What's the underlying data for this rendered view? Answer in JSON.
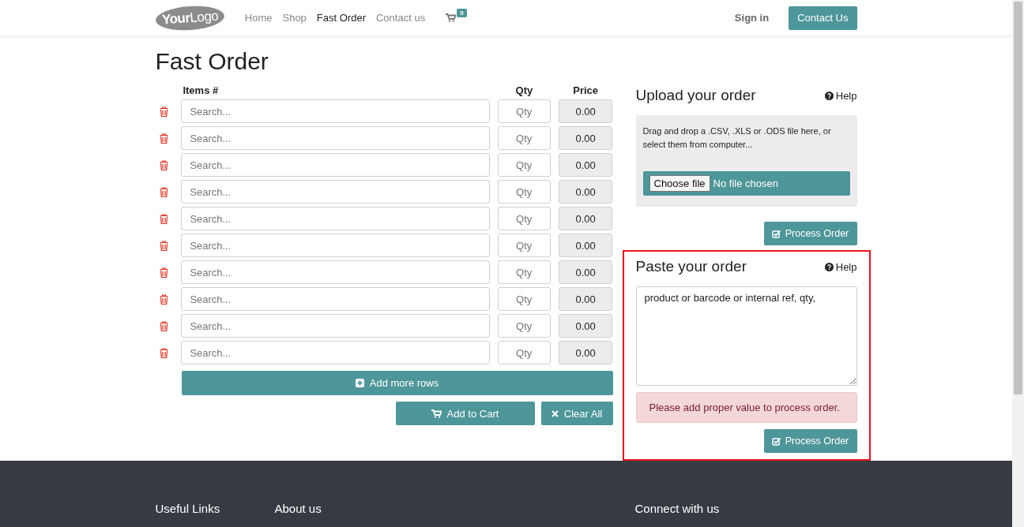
{
  "navbar": {
    "logo": {
      "bold": "Your",
      "light": "Logo"
    },
    "links": [
      {
        "label": "Home",
        "selected": false
      },
      {
        "label": "Shop",
        "selected": false
      },
      {
        "label": "Fast Order",
        "selected": true
      },
      {
        "label": "Contact us",
        "selected": false
      }
    ],
    "cart_count": "0",
    "sign_in": "Sign in",
    "contact_button": "Contact Us"
  },
  "title": "Fast Order",
  "order_table": {
    "columns": [
      "Items #",
      "Qty",
      "Price"
    ],
    "rows": [
      {
        "item_placeholder": "Search...",
        "qty_placeholder": "Qty",
        "price": "0.00"
      },
      {
        "item_placeholder": "Search...",
        "qty_placeholder": "Qty",
        "price": "0.00"
      },
      {
        "item_placeholder": "Search...",
        "qty_placeholder": "Qty",
        "price": "0.00"
      },
      {
        "item_placeholder": "Search...",
        "qty_placeholder": "Qty",
        "price": "0.00"
      },
      {
        "item_placeholder": "Search...",
        "qty_placeholder": "Qty",
        "price": "0.00"
      },
      {
        "item_placeholder": "Search...",
        "qty_placeholder": "Qty",
        "price": "0.00"
      },
      {
        "item_placeholder": "Search...",
        "qty_placeholder": "Qty",
        "price": "0.00"
      },
      {
        "item_placeholder": "Search...",
        "qty_placeholder": "Qty",
        "price": "0.00"
      },
      {
        "item_placeholder": "Search...",
        "qty_placeholder": "Qty",
        "price": "0.00"
      },
      {
        "item_placeholder": "Search...",
        "qty_placeholder": "Qty",
        "price": "0.00"
      }
    ],
    "add_rows": "Add more rows",
    "add_to_cart": "Add to Cart",
    "clear_all": "Clear All"
  },
  "upload": {
    "title": "Upload your order",
    "help": "Help",
    "hint": "Drag and drop a .CSV, .XLS or .ODS file here, or select them from computer...",
    "choose_file": "Choose file",
    "file_status": "No file chosen",
    "button": "Process Order"
  },
  "paste": {
    "title": "Paste your order",
    "help": "Help",
    "value": "product or barcode or internal ref, qty,",
    "error": "Please add proper value to process order.",
    "button": "Process Order"
  },
  "footer": {
    "headings": [
      "Useful Links",
      "About us",
      "Connect with us"
    ]
  }
}
